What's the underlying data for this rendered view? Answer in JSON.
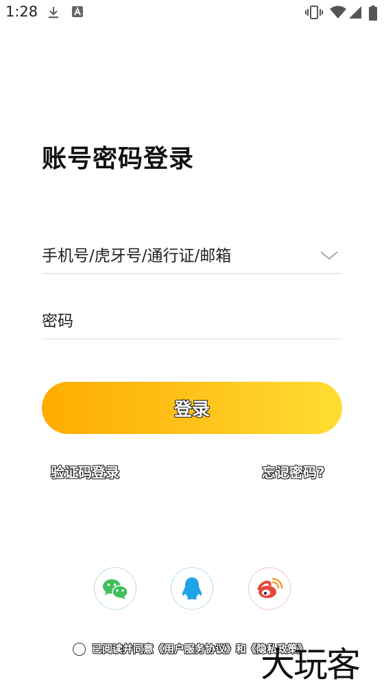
{
  "status_bar": {
    "time": "1:28",
    "icons": [
      "download-icon",
      "a-icon",
      "vibrate-icon",
      "wifi-icon",
      "signal-icon",
      "battery-icon"
    ]
  },
  "page": {
    "title": "账号密码登录"
  },
  "form": {
    "account_placeholder": "手机号/虎牙号/通行证/邮箱",
    "account_value": "",
    "password_placeholder": "密码",
    "password_value": "",
    "login_label": "登录"
  },
  "links": {
    "sms_login": "验证码登录",
    "forgot_password": "忘记密码?"
  },
  "social": [
    {
      "name": "wechat",
      "icon": "wechat-icon",
      "color": "#3fc05a"
    },
    {
      "name": "qq",
      "icon": "qq-icon",
      "color": "#1ea3e6"
    },
    {
      "name": "weibo",
      "icon": "weibo-icon",
      "color": "#e8473b"
    }
  ],
  "agreement": {
    "prefix": "已阅读并同意",
    "user_agreement": "《用户服务协议》",
    "conjunction": "和",
    "privacy_policy": "《隐私政策》"
  },
  "watermark": "大玩客",
  "colors": {
    "button_gradient_start": "#ffab00",
    "button_gradient_end": "#ffdd33"
  }
}
